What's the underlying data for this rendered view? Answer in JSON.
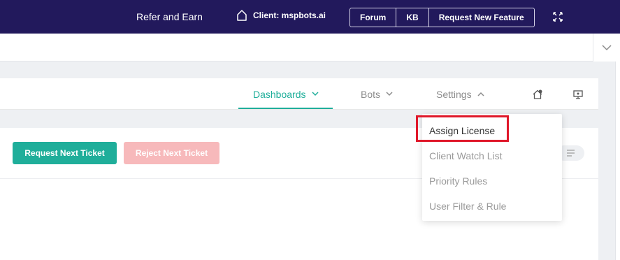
{
  "topbar": {
    "refer_label": "Refer and Earn",
    "client_label": "Client: mspbots.ai",
    "buttons": [
      "Forum",
      "KB",
      "Request New Feature"
    ]
  },
  "nav": {
    "items": [
      {
        "label": "Dashboards",
        "active": true
      },
      {
        "label": "Bots",
        "active": false
      },
      {
        "label": "Settings",
        "active": false
      }
    ]
  },
  "toolbar": {
    "request_label": "Request Next Ticket",
    "reject_label": "Reject Next Ticket"
  },
  "settings_menu": {
    "items": [
      "Assign License",
      "Client Watch List",
      "Priority Rules",
      "User Filter & Rule"
    ],
    "highlighted": "Assign License"
  },
  "colors": {
    "topbar_bg": "#22195c",
    "accent": "#1fae9a",
    "reject_bg": "#f7b9bb",
    "highlight": "#e0182a"
  }
}
